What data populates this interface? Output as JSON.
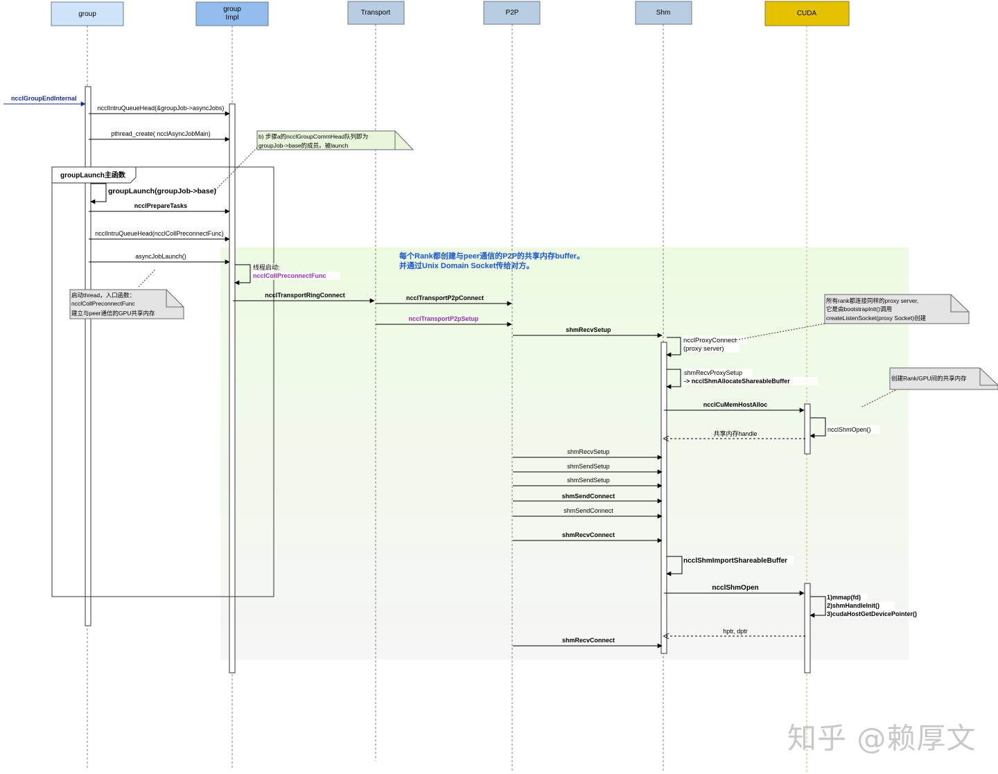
{
  "participants": [
    {
      "id": "group",
      "label": "group",
      "fill": "#cfe5fb"
    },
    {
      "id": "groupimpl",
      "label": "group\nImpl",
      "fill": "#92bcec"
    },
    {
      "id": "transport",
      "label": "Transport",
      "fill": "#b9cde2"
    },
    {
      "id": "p2p",
      "label": "P2P",
      "fill": "#b9cde2"
    },
    {
      "id": "shm",
      "label": "Shm",
      "fill": "#b9cde2"
    },
    {
      "id": "cuda",
      "label": "CUDA",
      "fill": "#e6c100"
    }
  ],
  "entry_label": "ncclGroupEndInternal",
  "frame_label": "groupLaunch主函数",
  "region_title": [
    "每个Rank都创建与peer通信的P2P的共享内存buffer。",
    "并通过Unix Domain Socket传给对方。"
  ],
  "messages": [
    {
      "id": "m1",
      "from": "group",
      "to": "groupimpl",
      "label": "ncclIntruQueueHead(&groupJob->asyncJobs)",
      "bold": false
    },
    {
      "id": "m2",
      "from": "group",
      "to": "groupimpl",
      "label": "pthread_create( ncclAsyncJobMain)",
      "bold": false
    },
    {
      "id": "m3",
      "from": "group",
      "to": "group",
      "label": "groupLaunch(groupJob->base)",
      "bold": true,
      "self": true
    },
    {
      "id": "m4",
      "from": "group",
      "to": "groupimpl",
      "label": "ncclPrepareTasks",
      "bold": true
    },
    {
      "id": "m5",
      "from": "group",
      "to": "groupimpl",
      "label": "ncclIntruQueueHead(ncclCollPreconnectFunc)",
      "bold": false
    },
    {
      "id": "m6",
      "from": "group",
      "to": "groupimpl",
      "label": "asyncJobLaunch()",
      "bold": false
    },
    {
      "id": "m7",
      "from": "groupimpl",
      "to": "groupimpl",
      "label": "线程启动:",
      "label2": "ncclCollPreconnectFunc",
      "self": true
    },
    {
      "id": "m8",
      "from": "groupimpl",
      "to": "transport",
      "label": "ncclTransportRingConnect",
      "bold": true
    },
    {
      "id": "m9",
      "from": "transport",
      "to": "p2p",
      "label": "ncclTransportP2pConnect",
      "bold": true
    },
    {
      "id": "m10",
      "from": "transport",
      "to": "p2p",
      "label": "ncclTransportP2pSetup",
      "bold": true,
      "color": "#9b30b8"
    },
    {
      "id": "m11",
      "from": "p2p",
      "to": "shm",
      "label": "shmRecvSetup",
      "bold": true
    },
    {
      "id": "m12",
      "from": "shm",
      "to": "shm",
      "label": "ncclProxyConnect",
      "label2": "(proxy server)",
      "self": true
    },
    {
      "id": "m13",
      "from": "shm",
      "to": "shm",
      "label": "shmRecvProxySetup",
      "label2": " -> ncclShmAllocateShareableBuffer",
      "self": true
    },
    {
      "id": "m14",
      "from": "shm",
      "to": "cuda",
      "label": "ncclCuMemHostAlloc",
      "bold": true
    },
    {
      "id": "m15",
      "from": "cuda",
      "to": "cuda",
      "label": "ncclShmOpen()",
      "self": true
    },
    {
      "id": "m16",
      "from": "cuda",
      "to": "shm",
      "label": "共享内存handle",
      "dashed": true
    },
    {
      "id": "m17",
      "from": "p2p",
      "to": "shm",
      "label": "shmRecvSetup",
      "bold": false
    },
    {
      "id": "m18",
      "from": "p2p",
      "to": "shm",
      "label": "shmSendSetup",
      "bold": false
    },
    {
      "id": "m19",
      "from": "p2p",
      "to": "shm",
      "label": "shmSendSetup",
      "bold": false
    },
    {
      "id": "m20",
      "from": "p2p",
      "to": "shm",
      "label": "shmSendConnect",
      "bold": true
    },
    {
      "id": "m21",
      "from": "p2p",
      "to": "shm",
      "label": "shmSendConnect",
      "bold": false
    },
    {
      "id": "m22",
      "from": "p2p",
      "to": "shm",
      "label": "shmRecvConnect",
      "bold": true
    },
    {
      "id": "m23",
      "from": "shm",
      "to": "shm",
      "label": "ncclShmImportShareableBuffer",
      "bold": true,
      "self": true
    },
    {
      "id": "m24",
      "from": "shm",
      "to": "cuda",
      "label": "ncclShmOpen",
      "bold": true
    },
    {
      "id": "m25",
      "from": "cuda",
      "to": "cuda",
      "label": "1)mmap(fd)",
      "label2": "2)shmHandleInit()",
      "label3": "3)cudaHostGetDevicePointer()",
      "bold": true,
      "self": true
    },
    {
      "id": "m26",
      "from": "cuda",
      "to": "shm",
      "label": "hptr, dptr",
      "dashed": true
    },
    {
      "id": "m27",
      "from": "p2p",
      "to": "shm",
      "label": "shmRecvConnect",
      "bold": true
    }
  ],
  "notes": [
    {
      "id": "note-b",
      "lines": [
        "b) 步骤a的ncclGroupCommHead队列即为",
        "groupJob->base的成员。被launch"
      ],
      "fill": "#eaf6dc"
    },
    {
      "id": "note-thread",
      "lines": [
        "启动thread，入口函数：",
        "ncclCollPreconnectFunc",
        "建立与peer通信的GPU共享内存"
      ],
      "fill": "#e4e4e4"
    },
    {
      "id": "note-proxy",
      "lines": [
        "所有rank都连接同样的proxy server,",
        "它是由bootstrapInit()调用",
        "createListenSocket(proxy Socket)创建"
      ],
      "fill": "#e4e4e4"
    },
    {
      "id": "note-shm",
      "lines": [
        "创建Rank/GPU间的共享内存"
      ],
      "fill": "#e4e4e4"
    }
  ],
  "watermark": "知乎 @赖厚文"
}
